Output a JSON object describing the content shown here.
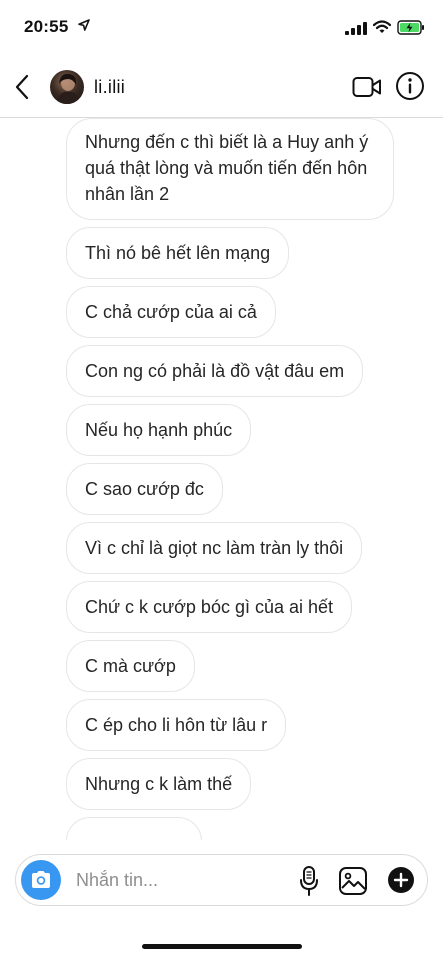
{
  "status_bar": {
    "time": "20:55",
    "icons": [
      "location-arrow-icon",
      "cellular-signal-icon",
      "wifi-icon",
      "battery-charging-icon"
    ]
  },
  "header": {
    "back_icon": "chevron-left-icon",
    "username": "li.ilii",
    "video_icon": "video-camera-icon",
    "info_icon": "info-icon"
  },
  "messages": [
    {
      "text": "Nhưng đến c thì biết là a Huy anh ý quá thật lòng và muốn tiến đến hôn nhân lần 2"
    },
    {
      "text": "Thì nó bê hết lên mạng"
    },
    {
      "text": "C chả cướp của ai cả"
    },
    {
      "text": "Con ng có phải là đồ vật đâu em"
    },
    {
      "text": "Nếu họ hạnh phúc"
    },
    {
      "text": "C sao cướp đc"
    },
    {
      "text": "Vì c chỉ là giọt nc làm tràn ly thôi"
    },
    {
      "text": "Chứ c k cướp bóc gì của ai hết"
    },
    {
      "text": "C mà cướp"
    },
    {
      "text": "C ép cho li hôn từ lâu r"
    },
    {
      "text": "Nhưng c k làm thế"
    }
  ],
  "composer": {
    "placeholder": "Nhắn tin...",
    "camera_icon": "camera-icon",
    "mic_icon": "microphone-icon",
    "gallery_icon": "image-gallery-icon",
    "plus_icon": "plus-circle-icon"
  },
  "colors": {
    "accent": "#3897f0",
    "bubble_border": "#e6e6e6",
    "text": "#262626",
    "placeholder": "#8e8e8e"
  }
}
